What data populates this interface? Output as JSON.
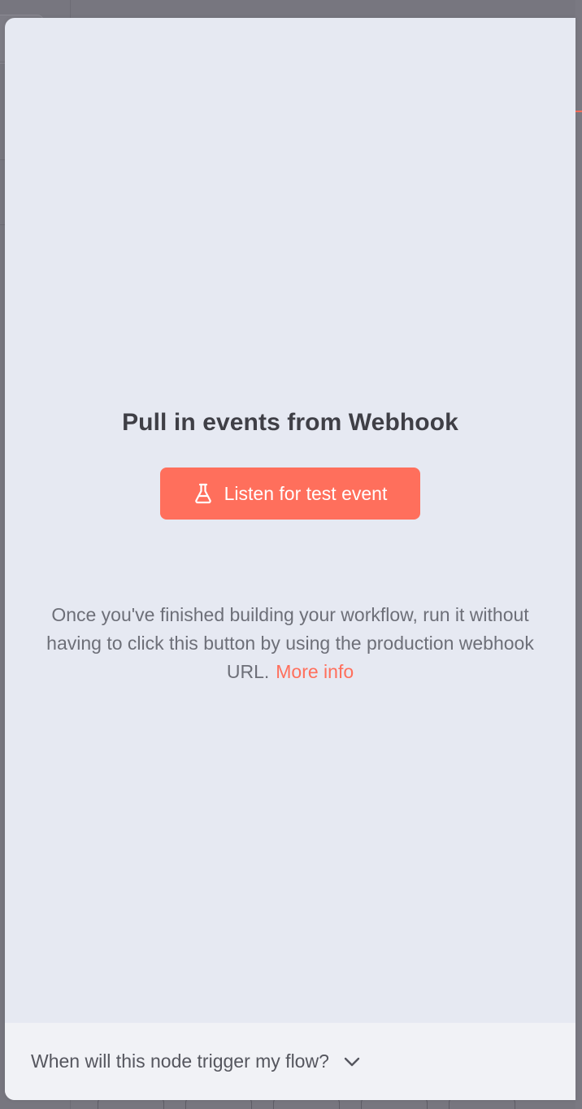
{
  "panel": {
    "title": "Pull in events from Webhook",
    "listen_button": {
      "label": "Listen for test event",
      "icon": "flask-icon",
      "color": "#ff6f5c"
    },
    "description": {
      "text": "Once you've finished building your workflow, run it without having to click this button by using the production webhook URL.",
      "link_label": "More info"
    },
    "footer": {
      "accordion_label": "When will this node trigger my flow?",
      "icon": "chevron-down-icon"
    }
  },
  "colors": {
    "accent": "#ff6f5c",
    "panel_background": "#e6e9f2",
    "footer_background": "#f1f2f6",
    "backdrop": "#77767f"
  }
}
